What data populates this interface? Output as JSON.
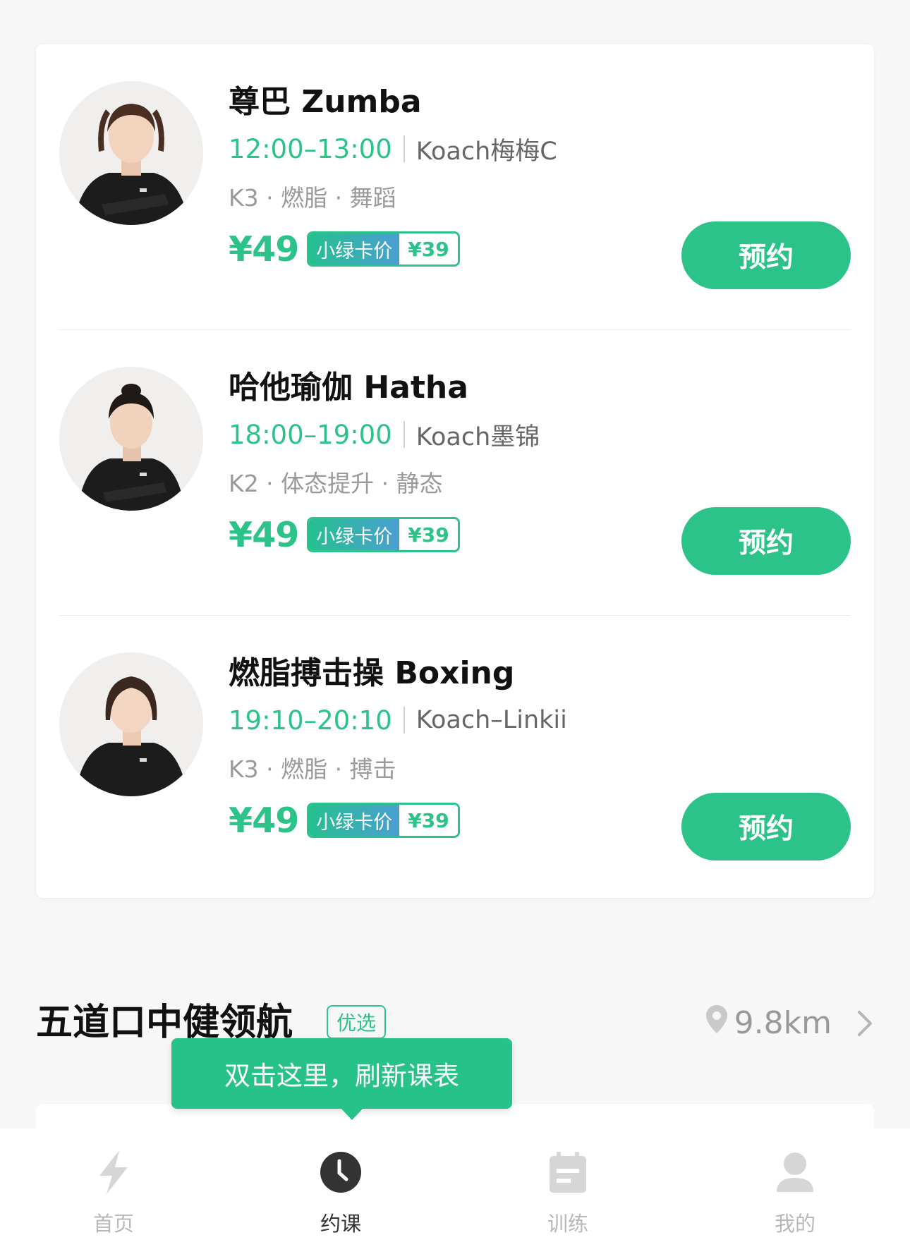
{
  "classes": [
    {
      "title": "尊巴 Zumba",
      "time": "12:00–13:00",
      "coach": "Koach梅梅C",
      "tags": "K3 · 燃脂 · 舞蹈",
      "price": "¥49",
      "member_label": "小绿卡价",
      "member_price": "¥39",
      "button": "预约"
    },
    {
      "title": "哈他瑜伽 Hatha",
      "time": "18:00–19:00",
      "coach": "Koach墨锦",
      "tags": "K2 · 体态提升 · 静态",
      "price": "¥49",
      "member_label": "小绿卡价",
      "member_price": "¥39",
      "button": "预约"
    },
    {
      "title": "燃脂搏击操 Boxing",
      "time": "19:10–20:10",
      "coach": "Koach–Linkii",
      "tags": "K3 · 燃脂 · 搏击",
      "price": "¥49",
      "member_label": "小绿卡价",
      "member_price": "¥39",
      "button": "预约"
    }
  ],
  "gym": {
    "name": "五道口中健领航",
    "badge": "优选",
    "distance": "9.8km"
  },
  "tooltip": "双击这里，刷新课表",
  "tabbar": {
    "items": [
      {
        "label": "首页",
        "icon": "lightning-icon"
      },
      {
        "label": "约课",
        "icon": "clock-icon"
      },
      {
        "label": "训练",
        "icon": "calendar-icon"
      },
      {
        "label": "我的",
        "icon": "person-icon"
      }
    ],
    "active": "约课"
  },
  "colors": {
    "accent": "#2cc38a",
    "muted": "#b8b8b8"
  }
}
